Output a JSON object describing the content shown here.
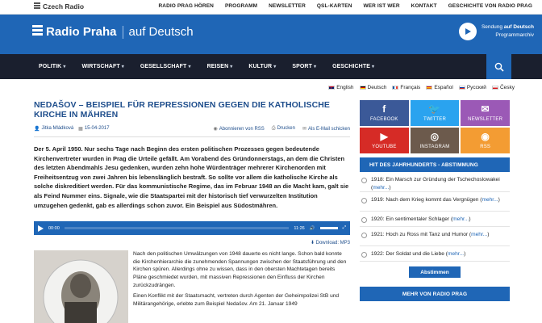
{
  "topbar": {
    "logo": "Czech Radio",
    "links": [
      "RADIO PRAG HÖREN",
      "PROGRAMM",
      "NEWSLETTER",
      "QSL-KARTEN",
      "WER IST WER",
      "KONTAKT",
      "GESCHICHTE VON RADIO PRAG"
    ]
  },
  "header": {
    "brand": "Radio Praha",
    "language": "auf Deutsch",
    "live_prefix": "Sendung ",
    "live_bold": "auf Deutsch",
    "schedule": "Programmarchiv"
  },
  "nav": {
    "items": [
      "POLITIK",
      "WIRTSCHAFT",
      "GESELLSCHAFT",
      "REISEN",
      "KULTUR",
      "SPORT",
      "GESCHICHTE"
    ]
  },
  "languages": [
    "English",
    "Deutsch",
    "Français",
    "Español",
    "Русский",
    "Česky"
  ],
  "article": {
    "title": "NEDAŠOV – BEISPIEL FÜR REPRESSIONEN GEGEN DIE KATHOLISCHE KIRCHE IN MÄHREN",
    "author": "Jitka Mládková",
    "date": "15-04-2017",
    "rss": "Abonnieren von RSS",
    "print": "Drucken",
    "email": "Als E-Mail schicken",
    "lead": "Der 5. April 1950. Nur sechs Tage nach Beginn des ersten politischen Prozesses gegen bedeutende Kirchenvertreter wurden in Prag die Urteile gefällt. Am Vorabend des Gründonnerstags, an dem die Christen des letzten Abendmahls Jesu gedenken, wurden zehn hohe Würdenträger mehrerer Kirchenorden mit Freiheitsentzug von zwei Jahren bis lebenslänglich bestraft. So sollte vor allem die katholische Kirche als solche diskreditiert werden. Für das kommunistische Regime, das im Februar 1948 an die Macht kam, galt sie als Feind Nummer eins. Signale, wie die Staatspartei mit der historisch tief verwurzelten Institution umzugehen gedenkt, gab es allerdings schon zuvor. Ein Beispiel aus Südostmähren.",
    "player_time": "00:00",
    "player_duration": "11:26",
    "download": "Download: MP3",
    "para1": "Nach den politischen Umwälzungen von 1948 dauerte es nicht lange. Schon bald konnte die Kirchenhierarchie die zunehmenden Spannungen zwischen der Staatsführung und den Kirchen spüren. Allerdings ohne zu wissen, dass in den obersten Machtetagen bereits Pläne geschmiedet wurden, mit massiven Repressionen den Einfluss der Kirchen zurückzudrängen.",
    "para2": "Einen Konflikt mit der Staatsmacht, vertreten durch Agenten der Geheimpolizei StB und Militärangehörige, erlebte zum Beispiel Nedašov. Am 21. Januar 1949"
  },
  "sidebar": {
    "social": [
      {
        "label": "FACEBOOK",
        "icon": "facebook-icon",
        "color": "#3b5998",
        "sym": "f"
      },
      {
        "label": "TWITTER",
        "icon": "twitter-icon",
        "color": "#2aa3ef",
        "sym": "🐦"
      },
      {
        "label": "NEWSLETTER",
        "icon": "mail-icon",
        "color": "#9b59b6",
        "sym": "✉"
      },
      {
        "label": "YOUTUBE",
        "icon": "youtube-icon",
        "color": "#d62b26",
        "sym": "▶"
      },
      {
        "label": "INSTAGRAM",
        "icon": "instagram-icon",
        "color": "#6c5a4c",
        "sym": "◎"
      },
      {
        "label": "RSS",
        "icon": "rss-icon",
        "color": "#f39c33",
        "sym": "◉"
      }
    ],
    "poll_title": "HIT DES JAHRHUNDERTS - ABSTIMMUNG",
    "poll": [
      {
        "text": "1918: Ein Marsch zur Gründung der Tschechoslowakei",
        "more": "mehr..."
      },
      {
        "text": "1919: Nach dem Krieg kommt das Vergnügen",
        "more": "mehr..."
      },
      {
        "text": "1920: Ein sentimentaler Schlager",
        "more": "mehr..."
      },
      {
        "text": "1921: Hoch zu Ross mit Tanz und Humor",
        "more": "mehr..."
      },
      {
        "text": "1922: Der Soldat und die Liebe",
        "more": "mehr..."
      }
    ],
    "vote_label": "Abstimmen",
    "more_title": "MEHR VON RADIO PRAG"
  }
}
